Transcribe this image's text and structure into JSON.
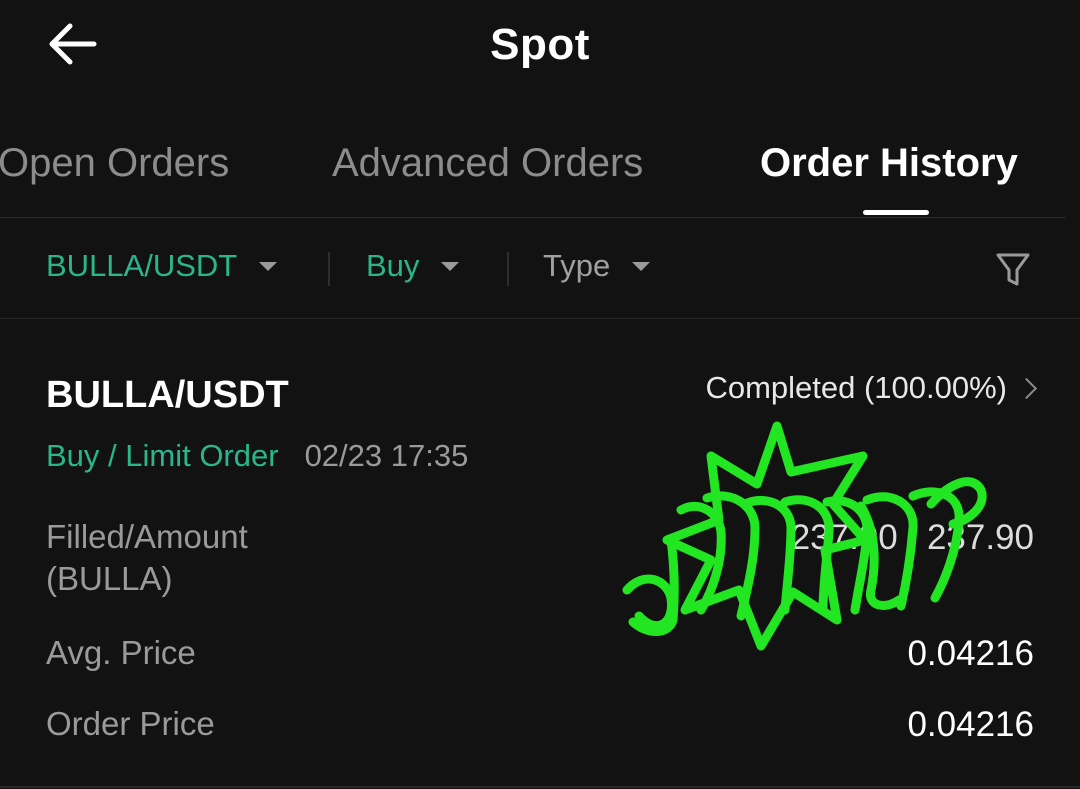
{
  "header": {
    "title": "Spot",
    "back_icon": "arrow-left-icon"
  },
  "tabs": [
    {
      "label": "Open Orders",
      "active": false
    },
    {
      "label": "Advanced Orders",
      "active": false
    },
    {
      "label": "Order History",
      "active": true
    }
  ],
  "filters": {
    "pair": "BULLA/USDT",
    "side": "Buy",
    "type": "Type",
    "filter_icon": "funnel-icon"
  },
  "order": {
    "pair": "BULLA/USDT",
    "status": "Completed (100.00%)",
    "side_type": "Buy / Limit Order",
    "time": "02/23 17:35",
    "rows": [
      {
        "label": "Filled/Amount\n(BULLA)",
        "value": "237.90 / 237.90"
      },
      {
        "label": "Avg. Price",
        "value": "0.04216"
      },
      {
        "label": "Order Price",
        "value": "0.04216"
      }
    ]
  },
  "colors": {
    "background": "#121212",
    "accent_green": "#2bb68a",
    "muted_text": "#9a9a9a",
    "signature_green": "#22e622"
  }
}
